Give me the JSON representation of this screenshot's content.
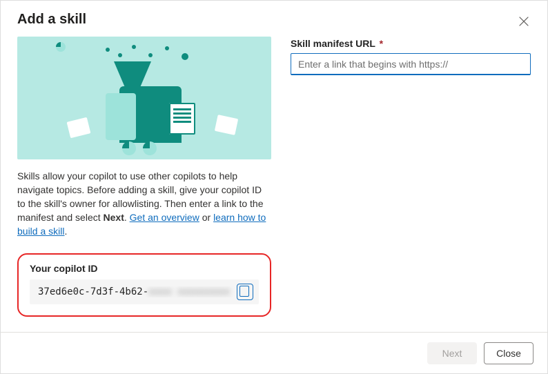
{
  "dialog": {
    "title": "Add a skill"
  },
  "description": {
    "text1": "Skills allow your copilot to use other copilots to help navigate topics. Before adding a skill, give your copilot ID to the skill's owner for allowlisting. Then enter a link to the manifest and select ",
    "bold": "Next",
    "dot": ". ",
    "link1": "Get an overview",
    "or": " or ",
    "link2": "learn how to build a skill",
    "dot2": "."
  },
  "copilot_id": {
    "label": "Your copilot ID",
    "value_visible": "37ed6e0c-7d3f-4b62-",
    "value_obscured": "xxxx xxxxxxxxx"
  },
  "form": {
    "manifest_label": "Skill manifest URL",
    "manifest_required": "*",
    "manifest_placeholder": "Enter a link that begins with https://"
  },
  "footer": {
    "next": "Next",
    "close": "Close"
  }
}
